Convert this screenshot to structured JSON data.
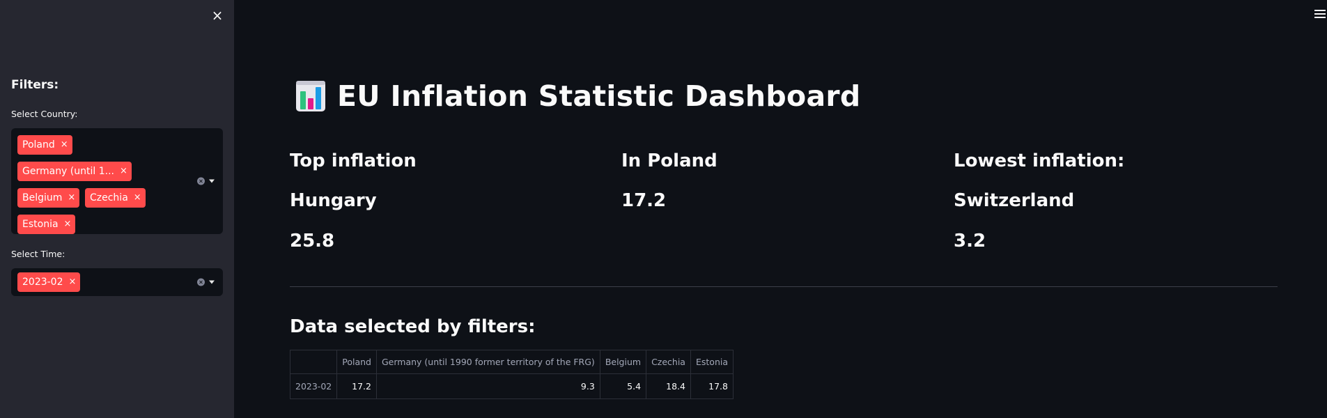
{
  "sidebar": {
    "filters_title": "Filters:",
    "country_label": "Select Country:",
    "countries": [
      {
        "label": "Poland"
      },
      {
        "label": "Germany (until 1..."
      },
      {
        "label": "Belgium"
      },
      {
        "label": "Czechia"
      },
      {
        "label": "Estonia"
      }
    ],
    "time_label": "Select Time:",
    "times": [
      {
        "label": "2023-02"
      }
    ],
    "close_icon": "×",
    "remove_icon": "×"
  },
  "header": {
    "title": "EU Inflation Statistic Dashboard",
    "title_icon": "bar-chart-icon"
  },
  "metrics": [
    {
      "label": "Top inflation",
      "name": "Hungary",
      "value": "25.8"
    },
    {
      "label": "In Poland",
      "name": "",
      "value": "17.2"
    },
    {
      "label": "Lowest inflation:",
      "name": "Switzerland",
      "value": "3.2"
    }
  ],
  "table": {
    "title": "Data selected by filters:",
    "columns": [
      "",
      "Poland",
      "Germany (until 1990 former territory of the FRG)",
      "Belgium",
      "Czechia",
      "Estonia"
    ],
    "rows": [
      [
        "2023-02",
        "17.2",
        "9.3",
        "5.4",
        "18.4",
        "17.8"
      ]
    ]
  },
  "colors": {
    "accent": "#ff4b4b",
    "background": "#0e1117",
    "sidebar": "#262730"
  }
}
